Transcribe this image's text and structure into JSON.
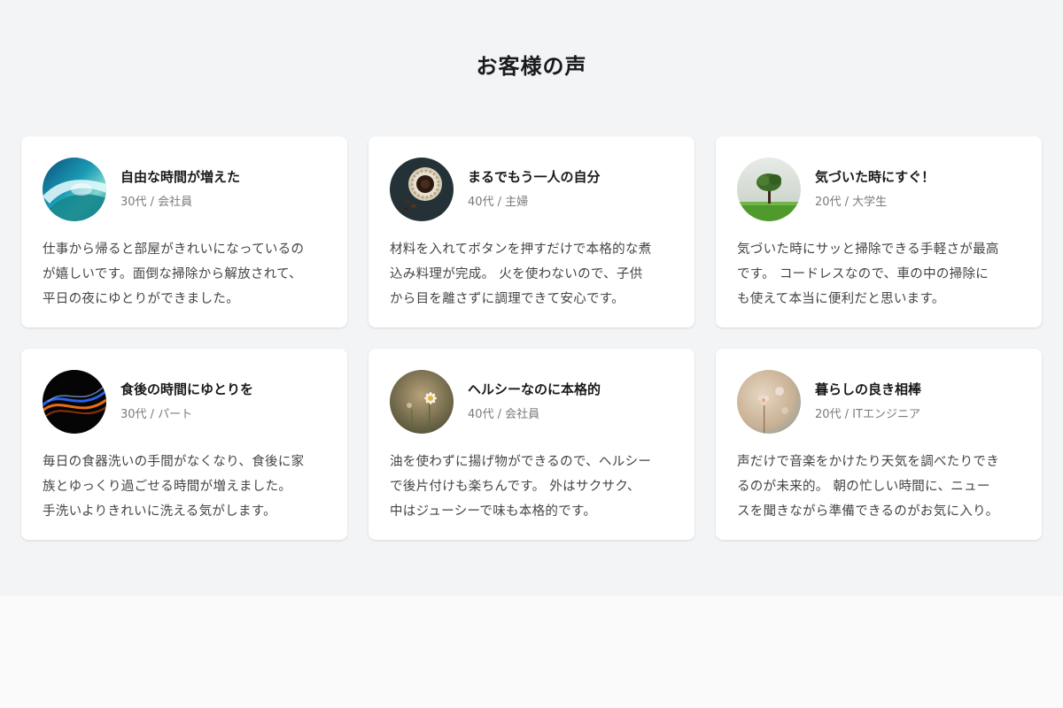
{
  "section": {
    "title": "お客様の声"
  },
  "testimonials": [
    {
      "avatar_icon": "ocean-wave-icon",
      "title": "自由な時間が増えた",
      "meta": "30代 / 会社員",
      "text": "仕事から帰ると部屋がきれいになっているの\nが嬉しいです。面倒な掃除から解放されて、\n平日の夜にゆとりができました。"
    },
    {
      "avatar_icon": "coffee-filter-icon",
      "title": "まるでもう一人の自分",
      "meta": "40代 / 主婦",
      "text": "材料を入れてボタンを押すだけで本格的な煮\n込み料理が完成。 火を使わないので、子供\nから目を離さずに調理できて安心です。"
    },
    {
      "avatar_icon": "tree-field-icon",
      "title": "気づいた時にすぐ！",
      "meta": "20代 / 大学生",
      "text": "気づいた時にサッと掃除できる手軽さが最高\nです。 コードレスなので、車の中の掃除に\nも使えて本当に便利だと思います。"
    },
    {
      "avatar_icon": "light-swirl-icon",
      "title": "食後の時間にゆとりを",
      "meta": "30代 / パート",
      "text": "毎日の食器洗いの手間がなくなり、食後に家\n族とゆっくり過ごせる時間が増えました。\n手洗いよりきれいに洗える気がします。"
    },
    {
      "avatar_icon": "daisy-flower-icon",
      "title": "ヘルシーなのに本格的",
      "meta": "40代 / 会社員",
      "text": "油を使わずに揚げ物ができるので、ヘルシー\nで後片付けも楽ちんです。 外はサクサク、\n中はジューシーで味も本格的です。"
    },
    {
      "avatar_icon": "pink-flower-icon",
      "title": "暮らしの良き相棒",
      "meta": "20代 / ITエンジニア",
      "text": "声だけで音楽をかけたり天気を調べたりでき\nるのが未来的。 朝の忙しい時間に、ニュー\nスを聞きながら準備できるのがお気に入り。"
    }
  ]
}
